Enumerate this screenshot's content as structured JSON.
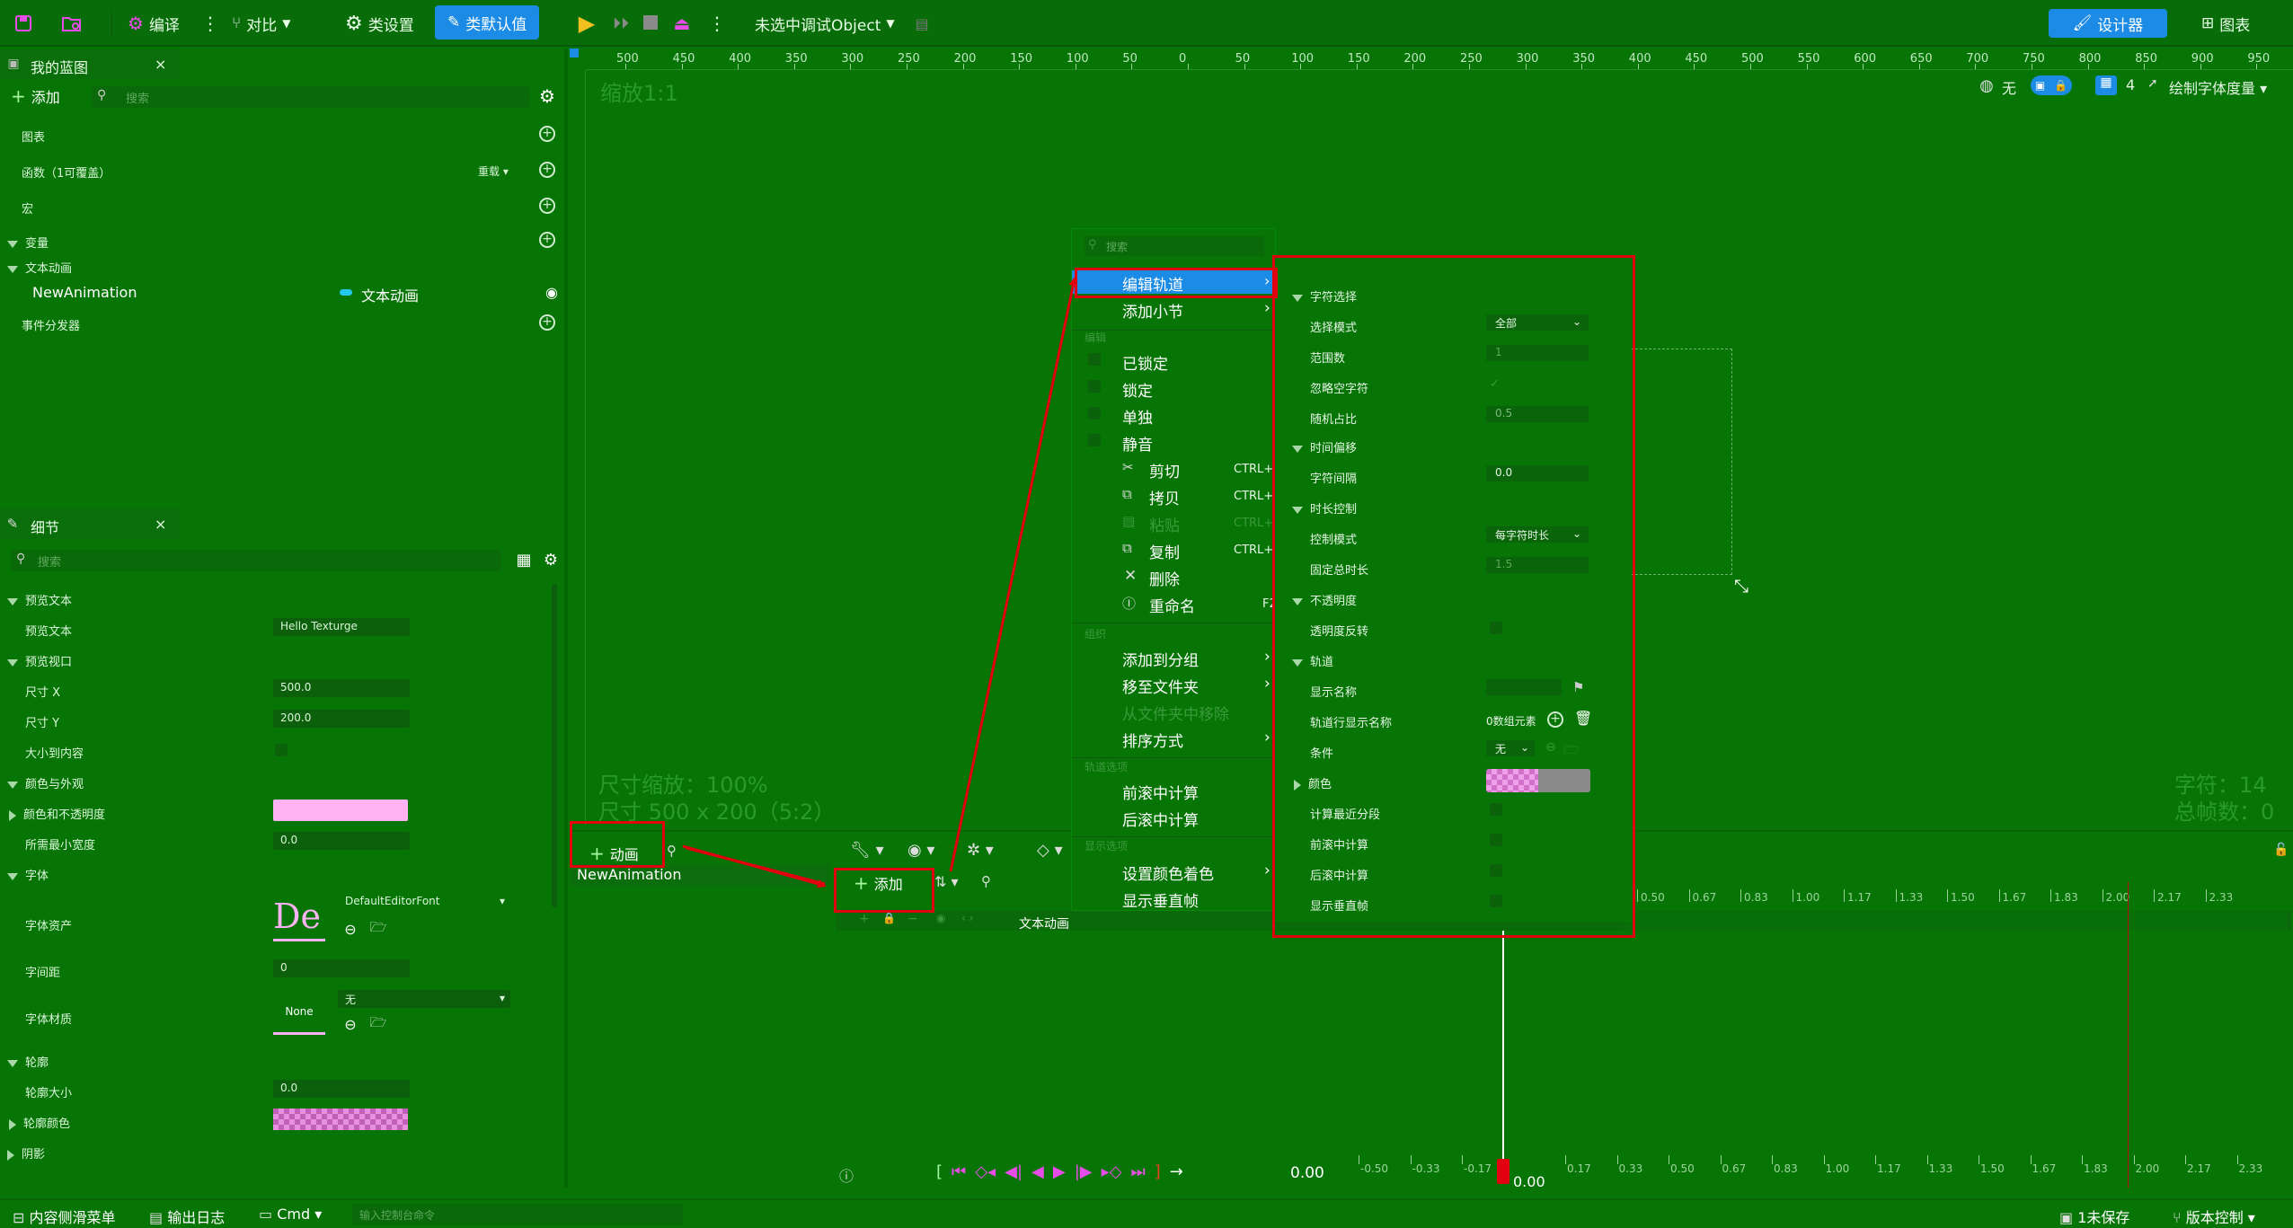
{
  "toolbar": {
    "compile": "编译",
    "diff": "对比",
    "class_settings": "类设置",
    "class_defaults": "类默认值",
    "debug_object": "未选中调试Object",
    "designer": "设计器",
    "graph": "图表"
  },
  "my_blueprint": {
    "title": "我的蓝图",
    "add": "添加",
    "search_placeholder": "搜索",
    "graphs": "图表",
    "functions": "函数（1可覆盖）",
    "override": "重载",
    "macros": "宏",
    "variables": "变量",
    "text_animation_cat": "文本动画",
    "animation_name": "NewAnimation",
    "animation_type": "文本动画",
    "event_dispatchers": "事件分发器"
  },
  "details": {
    "title": "细节",
    "search_placeholder": "搜索",
    "preview_text_section": "预览文本",
    "preview_text_label": "预览文本",
    "preview_text_value": "Hello Texturge",
    "preview_viewport": "预览视口",
    "size_x_label": "尺寸 X",
    "size_x_value": "500.0",
    "size_y_label": "尺寸 Y",
    "size_y_value": "200.0",
    "fit_content": "大小到内容",
    "color_appearance": "颜色与外观",
    "color_opacity": "颜色和不透明度",
    "min_width": "所需最小宽度",
    "min_width_value": "0.0",
    "font_section": "字体",
    "font_asset": "字体资产",
    "font_preview": "De",
    "font_name": "DefaultEditorFont",
    "letter_spacing": "字间距",
    "letter_spacing_value": "0",
    "font_material": "字体材质",
    "font_material_none": "None",
    "font_material_value": "无",
    "outline_section": "轮廓",
    "outline_size": "轮廓大小",
    "outline_size_value": "0.0",
    "outline_color": "轮廓颜色",
    "shadow_section": "阴影",
    "pink_color": "#ffb3f5"
  },
  "viewport": {
    "zoom": "缩放1:1",
    "view_none": "无",
    "grid_count": "4",
    "draw_font_measure": "绘制字体度量",
    "size_scale": "尺寸缩放：100%",
    "size": "尺寸 500 x 200（5:2）",
    "chars": "字符：14",
    "frames": "总帧数：0",
    "ruler": [
      "500",
      "450",
      "400",
      "350",
      "300",
      "250",
      "200",
      "150",
      "100",
      "50",
      "0",
      "50",
      "100",
      "150",
      "200",
      "250",
      "300",
      "350",
      "400",
      "450",
      "500",
      "550",
      "600",
      "650",
      "700",
      "750",
      "800",
      "850",
      "900",
      "950"
    ]
  },
  "animation": {
    "add_animation": "动画",
    "animation_item": "NewAnimation",
    "add": "添加",
    "track_name": "文本动画",
    "time_value": "0.00",
    "playhead_time": "0.00",
    "top_ticks": [
      "0.50",
      "0.67",
      "0.83",
      "1.00",
      "1.17",
      "1.33",
      "1.50",
      "1.67",
      "1.83",
      "2.00",
      "2.17",
      "2.33"
    ],
    "bottom_ticks": [
      "-0.50",
      "-0.33",
      "-0.17",
      "0.17",
      "0.33",
      "0.50",
      "0.67",
      "0.83",
      "1.00",
      "1.17",
      "1.33",
      "1.50",
      "1.67",
      "1.83",
      "2.00",
      "2.17",
      "2.33"
    ]
  },
  "context_menu": {
    "search_placeholder": "搜索",
    "edit_track": "编辑轨道",
    "add_section": "添加小节",
    "section_edit": "编辑",
    "locked": "已锁定",
    "lock": "锁定",
    "solo": "单独",
    "mute": "静音",
    "cut": "剪切",
    "cut_sc": "CTRL+X",
    "copy": "拷贝",
    "copy_sc": "CTRL+C",
    "paste": "粘贴",
    "paste_sc": "CTRL+V",
    "duplicate": "复制",
    "duplicate_sc": "CTRL+D",
    "delete": "删除",
    "rename": "重命名",
    "rename_sc": "F2",
    "section_organize": "组织",
    "add_to_group": "添加到分组",
    "move_to_folder": "移至文件夹",
    "remove_from_folder": "从文件夹中移除",
    "sort": "排序方式",
    "section_track_options": "轨道选项",
    "pre_roll": "前滚中计算",
    "post_roll": "后滚中计算",
    "section_display": "显示选项",
    "set_color": "设置颜色着色",
    "show_vertical_frame": "显示垂直帧"
  },
  "track_props": {
    "char_select": "字符选择",
    "select_mode": "选择模式",
    "select_mode_value": "全部",
    "range_start": "范围数",
    "range_start_value": "1",
    "ignore_whitespace": "忽略空字符",
    "random_ratio": "随机占比",
    "random_ratio_value": "0.5",
    "time_offset": "时间偏移",
    "char_interval": "字符间隔",
    "char_interval_value": "0.0",
    "duration_control": "时长控制",
    "control_mode": "控制模式",
    "control_mode_value": "每字符时长",
    "fixed_total": "固定总时长",
    "fixed_total_value": "1.5",
    "opacity": "不透明度",
    "opacity_invert": "透明度反转",
    "track": "轨道",
    "display_name": "显示名称",
    "row_display_name": "轨道行显示名称",
    "elements_count": "0数组元素",
    "condition": "条件",
    "condition_value": "无",
    "color": "颜色",
    "eval_nearest": "计算最近分段",
    "pre_roll": "前滚中计算",
    "post_roll": "后滚中计算",
    "show_vertical_frame": "显示垂直帧"
  },
  "statusbar": {
    "content_drawer": "内容侧滑菜单",
    "output_log": "输出日志",
    "cmd": "Cmd",
    "console_placeholder": "输入控制台命令",
    "unsaved": "1未保存",
    "source_control": "版本控制"
  },
  "colors": {
    "background": "#077506",
    "highlight": "#1b8be6",
    "annotation": "#e00010",
    "accent_green": "#a8f8a0"
  }
}
